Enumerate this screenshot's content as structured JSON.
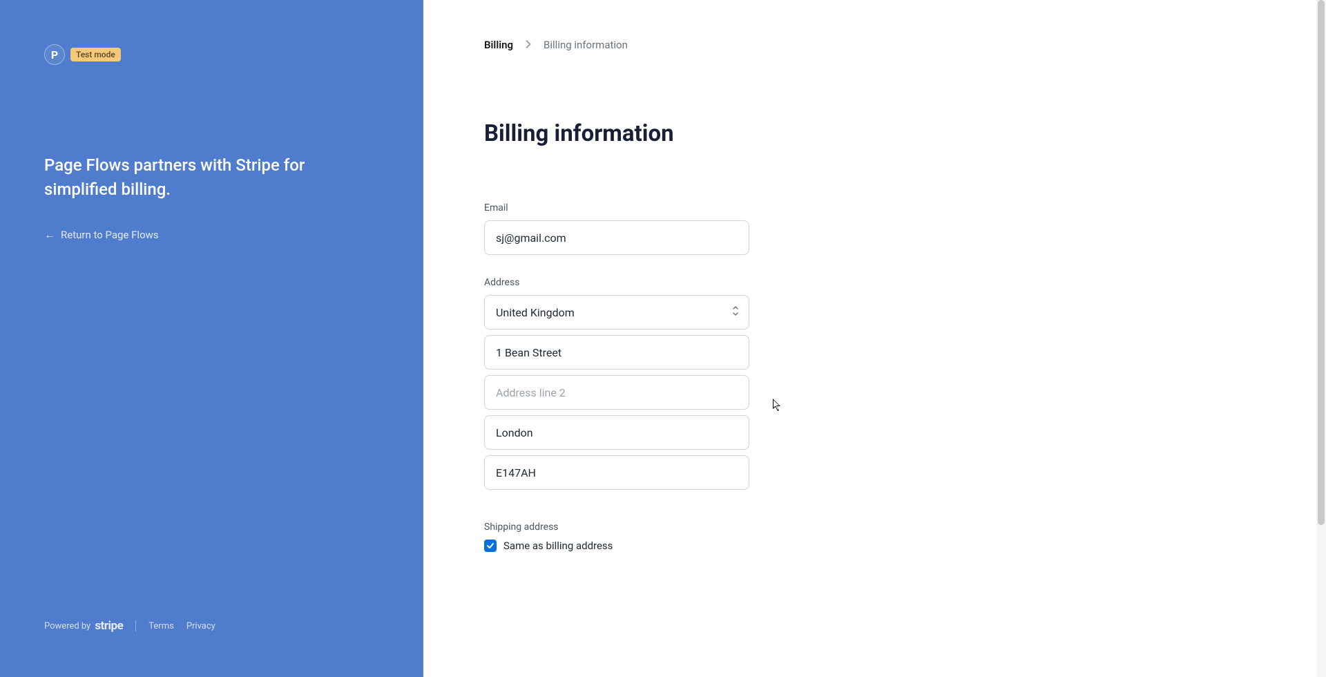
{
  "sidebar": {
    "brand_letter": "P",
    "badge": "Test mode",
    "heading": "Page Flows partners with Stripe for simplified billing.",
    "return_link": "Return to Page Flows",
    "footer": {
      "powered_by": "Powered by",
      "stripe": "stripe",
      "terms": "Terms",
      "privacy": "Privacy"
    }
  },
  "breadcrumb": {
    "root": "Billing",
    "current": "Billing information"
  },
  "page_title": "Billing information",
  "form": {
    "email_label": "Email",
    "email_value": "sj@gmail.com",
    "address_label": "Address",
    "country_value": "United Kingdom",
    "address1_value": "1 Bean Street",
    "address2_placeholder": "Address line 2",
    "address2_value": "",
    "city_value": "London",
    "postal_value": "E147AH",
    "shipping_label": "Shipping address",
    "same_as_billing": "Same as billing address"
  }
}
